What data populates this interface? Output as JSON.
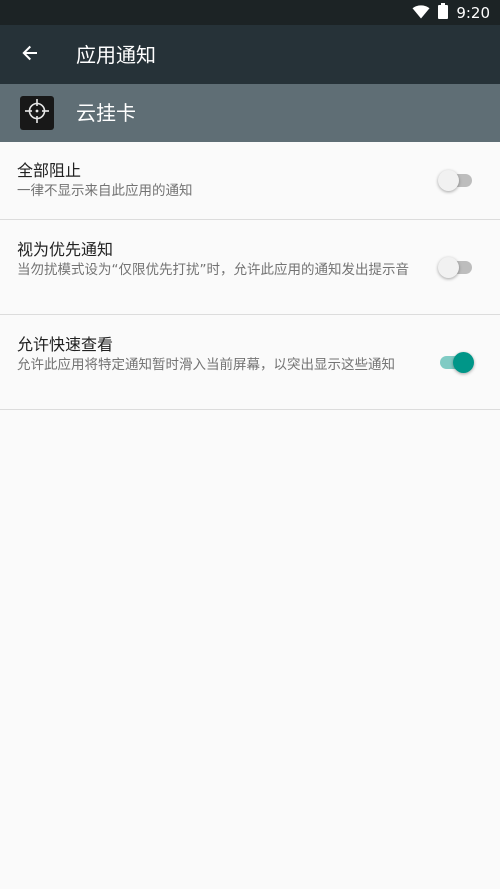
{
  "status_bar": {
    "time": "9:20",
    "icons": [
      "wifi-icon",
      "battery-icon"
    ]
  },
  "toolbar": {
    "back_icon": "arrow-back-icon",
    "title": "应用通知"
  },
  "app": {
    "icon": "crosshair-icon",
    "name": "云挂卡"
  },
  "settings": [
    {
      "title": "全部阻止",
      "description": "一律不显示来自此应用的通知",
      "toggle": false
    },
    {
      "title": "视为优先通知",
      "description": "当勿扰模式设为“仅限优先打扰”时，允许此应用的通知发出提示音",
      "toggle": false
    },
    {
      "title": "允许快速查看",
      "description": "允许此应用将特定通知暂时滑入当前屏幕，以突出显示这些通知",
      "toggle": true
    }
  ],
  "colors": {
    "status_bar": "#1c2325",
    "toolbar": "#263238",
    "app_header": "#5f6e75",
    "accent": "#009688",
    "background": "#fafafa"
  }
}
